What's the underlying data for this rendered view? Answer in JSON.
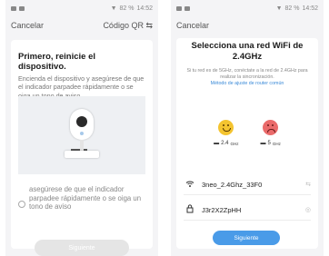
{
  "left": {
    "status": {
      "battery": "82 %",
      "time": "14:52"
    },
    "nav": {
      "cancel": "Cancelar",
      "qr": "Código QR ⇆"
    },
    "title": "Primero, reinicie el dispositivo.",
    "description": "Encienda el dispositivo y asegúrese de que el indicador parpadee rápidamente o se oiga un tono de aviso",
    "check_label": "asegúrese de que el indicador parpadee rápidamente o se oiga un tono de aviso",
    "next_button": "Siguiente"
  },
  "right": {
    "status": {
      "battery": "82 %",
      "time": "14:52"
    },
    "nav": {
      "cancel": "Cancelar"
    },
    "title": "Selecciona una red WiFi de 2.4GHz",
    "description": "Si tu red es de 5GHz, conéctate a la red de 2.4GHz para realizar la sincronización.",
    "link": "Método de ajuste de router común",
    "band_good": "2.4",
    "band_good_unit": "GHz",
    "band_bad": "5",
    "band_bad_unit": "GHz",
    "ssid": "3neo_2.4Ghz_33F0",
    "password": "J3r2X2ZpHH",
    "next_button": "Siguiente",
    "icons": {
      "wifi": "wifi-icon",
      "lock": "lock-icon",
      "swap": "swap-icon",
      "eye": "eye-icon"
    },
    "accent": "#4a9be8"
  }
}
